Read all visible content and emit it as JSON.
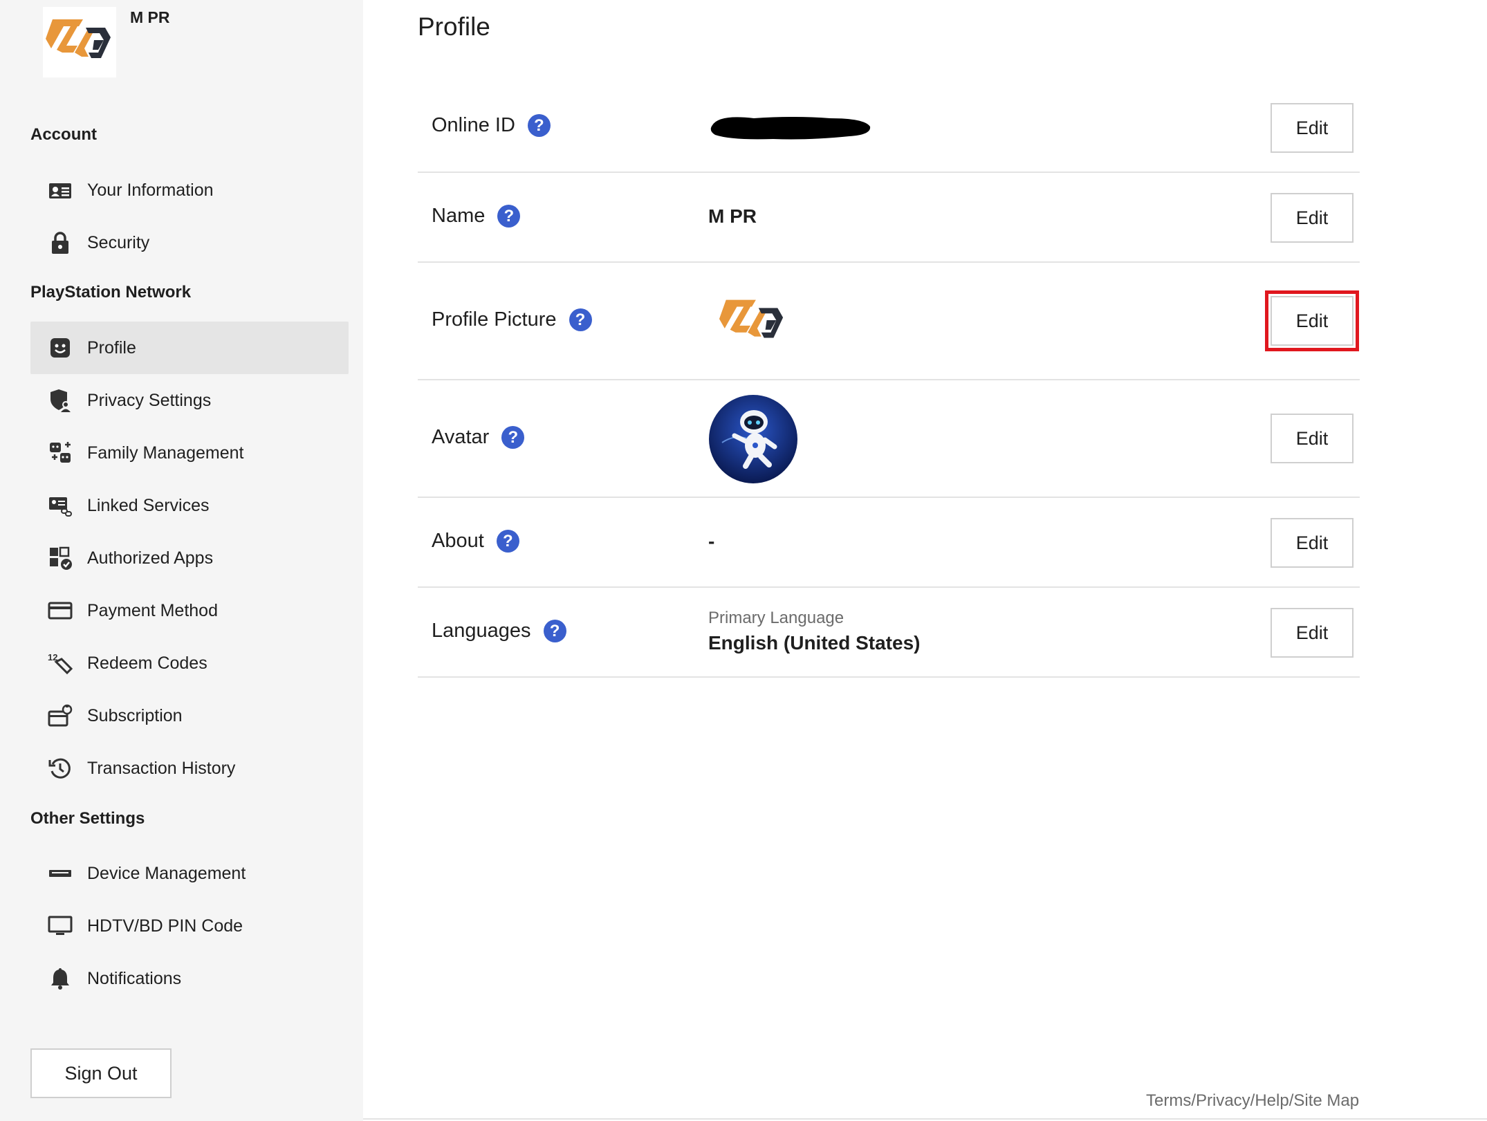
{
  "sidebar": {
    "user_name": "M PR",
    "sections": {
      "account": "Account",
      "psn": "PlayStation Network",
      "other": "Other Settings"
    },
    "items": [
      {
        "label": "Your Information",
        "icon": "id-card-icon"
      },
      {
        "label": "Security",
        "icon": "lock-icon"
      },
      {
        "label": "Profile",
        "icon": "smiley-icon",
        "active": true
      },
      {
        "label": "Privacy Settings",
        "icon": "shield-user-icon"
      },
      {
        "label": "Family Management",
        "icon": "family-icon"
      },
      {
        "label": "Linked Services",
        "icon": "linked-card-icon"
      },
      {
        "label": "Authorized Apps",
        "icon": "apps-check-icon"
      },
      {
        "label": "Payment Method",
        "icon": "credit-card-icon"
      },
      {
        "label": "Redeem Codes",
        "icon": "redeem-code-icon"
      },
      {
        "label": "Subscription",
        "icon": "subscription-icon"
      },
      {
        "label": "Transaction History",
        "icon": "history-icon"
      },
      {
        "label": "Device Management",
        "icon": "console-icon"
      },
      {
        "label": "HDTV/BD PIN Code",
        "icon": "monitor-icon"
      },
      {
        "label": "Notifications",
        "icon": "bell-icon"
      }
    ],
    "sign_out": "Sign Out"
  },
  "main": {
    "title": "Profile",
    "help_glyph": "?",
    "edit_label": "Edit",
    "rows": {
      "online_id": {
        "label": "Online ID",
        "value": ""
      },
      "name": {
        "label": "Name",
        "value": "M PR"
      },
      "profile_picture": {
        "label": "Profile Picture"
      },
      "avatar": {
        "label": "Avatar"
      },
      "about": {
        "label": "About",
        "value": "-"
      },
      "languages": {
        "label": "Languages",
        "sublabel": "Primary Language",
        "value": "English (United States)"
      }
    }
  },
  "footer": {
    "links": "Terms/Privacy/Help/Site Map"
  },
  "colors": {
    "accent": "#3a5fcd",
    "highlight": "#e0171e",
    "logo_orange": "#e8973a",
    "logo_dark": "#2a2f3a"
  }
}
